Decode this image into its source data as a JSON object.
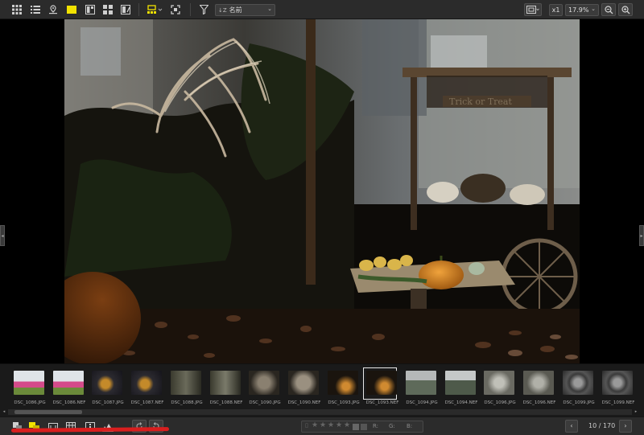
{
  "toolbar_top": {
    "sort_label": "名前",
    "sort_icon": "sort-az-icon",
    "x1_label": "x1",
    "zoom_level": "17.9%",
    "accent_yellow": "#f2e200"
  },
  "filmstrip": {
    "thumbnails": [
      {
        "name": "DSC_1086.JPG"
      },
      {
        "name": "DSC_1086.NEF"
      },
      {
        "name": "DSC_1087.JPG"
      },
      {
        "name": "DSC_1087.NEF"
      },
      {
        "name": "DSC_1088.JPG"
      },
      {
        "name": "DSC_1088.NEF"
      },
      {
        "name": "DSC_1090.JPG"
      },
      {
        "name": "DSC_1090.NEF"
      },
      {
        "name": "DSC_1093.JPG"
      },
      {
        "name": "DSC_1093.NEF"
      },
      {
        "name": "DSC_1094.JPG"
      },
      {
        "name": "DSC_1094.NEF"
      },
      {
        "name": "DSC_1096.JPG"
      },
      {
        "name": "DSC_1096.NEF"
      },
      {
        "name": "DSC_1099.JPG"
      },
      {
        "name": "DSC_1099.NEF"
      }
    ],
    "selected_index": 9
  },
  "toolbar_bottom": {
    "rgb_labels": {
      "r": "R:",
      "g": "G:",
      "b": "B:"
    },
    "page_counter": "10 / 170"
  }
}
